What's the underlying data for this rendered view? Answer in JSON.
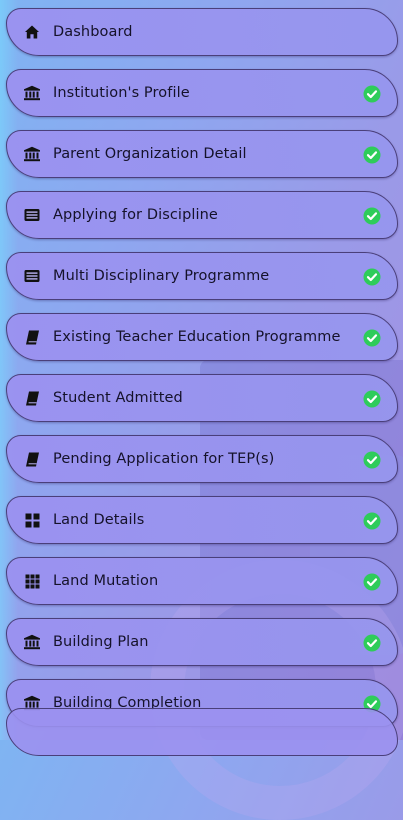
{
  "colors": {
    "check": "#2ecc5a",
    "icon": "#111111"
  },
  "menu": {
    "items": [
      {
        "label": "Dashboard",
        "icon": "home-icon",
        "completed": false
      },
      {
        "label": "Institution's Profile",
        "icon": "institution-icon",
        "completed": true
      },
      {
        "label": "Parent Organization Detail",
        "icon": "institution-icon",
        "completed": true
      },
      {
        "label": "Applying for Discipline",
        "icon": "list-card-icon",
        "completed": true
      },
      {
        "label": "Multi Disciplinary Programme",
        "icon": "list-card-icon",
        "completed": true
      },
      {
        "label": "Existing Teacher Education Programme",
        "icon": "book-icon",
        "completed": true
      },
      {
        "label": "Student Admitted",
        "icon": "book-icon",
        "completed": true
      },
      {
        "label": "Pending Application for TEP(s)",
        "icon": "book-icon",
        "completed": true
      },
      {
        "label": "Land Details",
        "icon": "grid-2x2-icon",
        "completed": true
      },
      {
        "label": "Land Mutation",
        "icon": "grid-3x3-icon",
        "completed": true
      },
      {
        "label": "Building Plan",
        "icon": "institution-icon",
        "completed": true
      },
      {
        "label": "Building Completion",
        "icon": "institution-icon",
        "completed": true
      }
    ]
  }
}
